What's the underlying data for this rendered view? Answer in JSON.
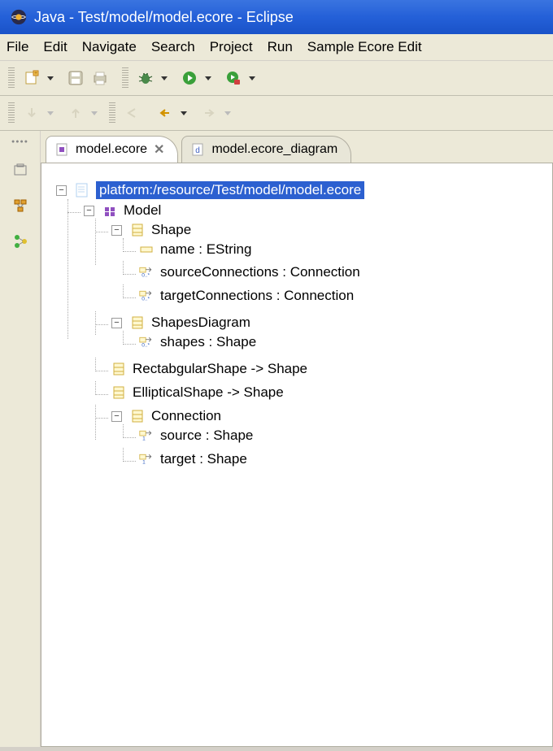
{
  "title": "Java - Test/model/model.ecore - Eclipse",
  "menu": {
    "file": "File",
    "edit": "Edit",
    "navigate": "Navigate",
    "search": "Search",
    "project": "Project",
    "run": "Run",
    "sample": "Sample Ecore Edit"
  },
  "tabs": {
    "active": "model.ecore",
    "inactive": "model.ecore_diagram",
    "close": "✕"
  },
  "tree": {
    "root": {
      "label": "platform:/resource/Test/model/model.ecore",
      "expander": "−"
    },
    "model": {
      "label": "Model",
      "expander": "−"
    },
    "shape": {
      "label": "Shape",
      "expander": "−",
      "attrs": {
        "name": "name : EString",
        "source": "sourceConnections : Connection",
        "target": "targetConnections : Connection"
      }
    },
    "shapesDiagram": {
      "label": "ShapesDiagram",
      "expander": "−",
      "attrs": {
        "shapes": "shapes : Shape"
      }
    },
    "rect": {
      "label": "RectabgularShape -> Shape"
    },
    "ellip": {
      "label": "EllipticalShape -> Shape"
    },
    "connection": {
      "label": "Connection",
      "expander": "−",
      "attrs": {
        "source": "source : Shape",
        "target": "target : Shape"
      }
    }
  },
  "icons": {
    "minus": "−",
    "plus": "+"
  }
}
